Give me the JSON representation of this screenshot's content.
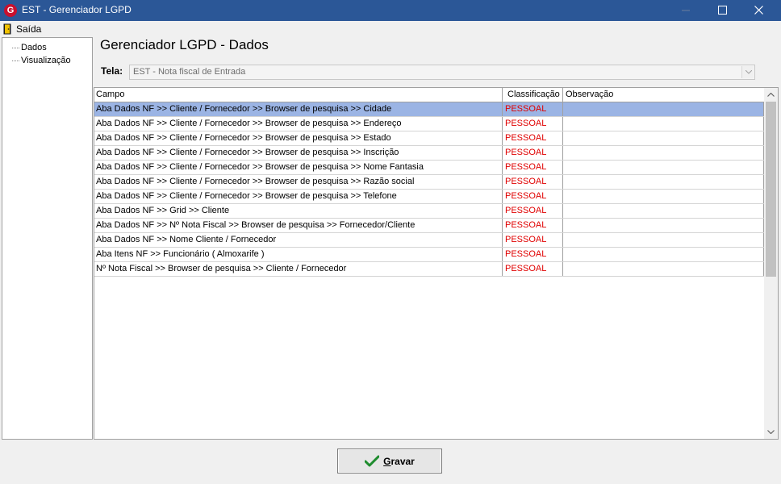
{
  "window": {
    "title": "EST - Gerenciador LGPD",
    "app_icon_letter": "G"
  },
  "menu": {
    "exit_label": "Saída"
  },
  "tree": {
    "items": [
      {
        "label": "Dados"
      },
      {
        "label": "Visualização"
      }
    ]
  },
  "main": {
    "title": "Gerenciador LGPD - Dados",
    "tela_label": "Tela:",
    "tela_value": "EST - Nota fiscal de Entrada"
  },
  "grid": {
    "columns": [
      "Campo",
      "Classificação",
      "Observação"
    ],
    "rows": [
      {
        "campo": "Aba Dados NF >> Cliente / Fornecedor >> Browser de pesquisa >> Cidade",
        "classificacao": "PESSOAL",
        "observacao": "",
        "selected": true
      },
      {
        "campo": "Aba Dados NF >> Cliente / Fornecedor >> Browser de pesquisa >> Endereço",
        "classificacao": "PESSOAL",
        "observacao": ""
      },
      {
        "campo": "Aba Dados NF >> Cliente / Fornecedor >> Browser de pesquisa >> Estado",
        "classificacao": "PESSOAL",
        "observacao": ""
      },
      {
        "campo": "Aba Dados NF >> Cliente / Fornecedor >> Browser de pesquisa >> Inscrição",
        "classificacao": "PESSOAL",
        "observacao": ""
      },
      {
        "campo": "Aba Dados NF >> Cliente / Fornecedor >> Browser de pesquisa >> Nome Fantasia",
        "classificacao": "PESSOAL",
        "observacao": ""
      },
      {
        "campo": "Aba Dados NF >> Cliente / Fornecedor >> Browser de pesquisa >> Razão social",
        "classificacao": "PESSOAL",
        "observacao": ""
      },
      {
        "campo": "Aba Dados NF >> Cliente / Fornecedor >> Browser de pesquisa >> Telefone",
        "classificacao": "PESSOAL",
        "observacao": ""
      },
      {
        "campo": "Aba Dados NF >> Grid  >> Cliente",
        "classificacao": "PESSOAL",
        "observacao": ""
      },
      {
        "campo": "Aba Dados NF >> Nº Nota Fiscal >> Browser de pesquisa >> Fornecedor/Cliente",
        "classificacao": "PESSOAL",
        "observacao": ""
      },
      {
        "campo": "Aba Dados NF >> Nome Cliente / Fornecedor",
        "classificacao": "PESSOAL",
        "observacao": ""
      },
      {
        "campo": "Aba Itens NF >> Funcionário ( Almoxarife )",
        "classificacao": "PESSOAL",
        "observacao": ""
      },
      {
        "campo": "Nº Nota Fiscal >> Browser de pesquisa >> Cliente / Fornecedor",
        "classificacao": "PESSOAL",
        "observacao": ""
      }
    ]
  },
  "footer": {
    "save_label_underlined": "G",
    "save_label_rest": "ravar"
  },
  "colors": {
    "titlebar": "#2b5797",
    "selected_row": "#9bb4e4",
    "classification_text": "#e00000",
    "save_check": "#1e8c2e"
  },
  "icons": [
    "app-logo-icon",
    "minimize-icon",
    "maximize-icon",
    "close-icon",
    "exit-door-icon",
    "dropdown-arrow-icon",
    "scroll-up-icon",
    "scroll-down-icon",
    "checkmark-icon"
  ]
}
